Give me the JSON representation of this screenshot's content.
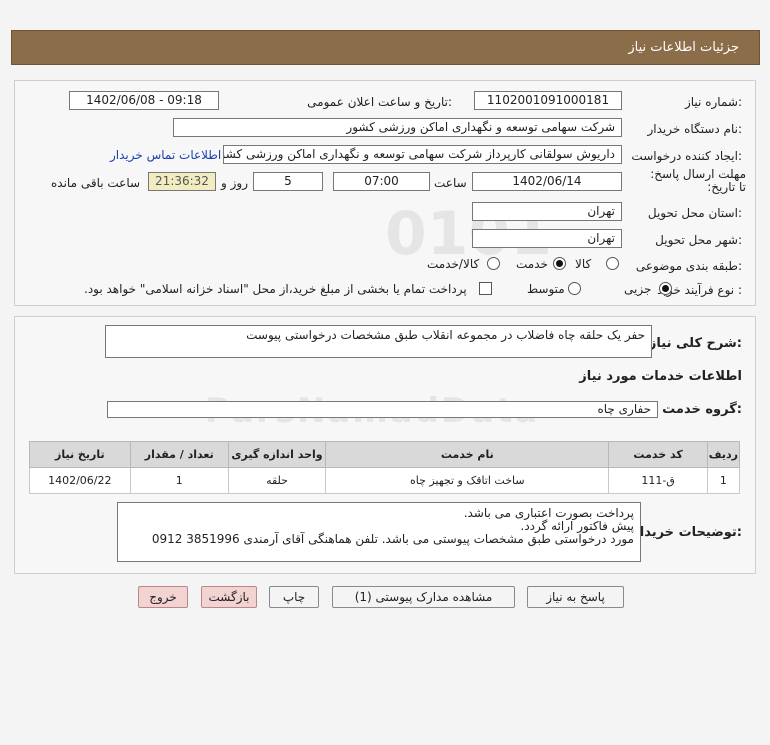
{
  "header": {
    "title": "جزئیات اطلاعات نیاز"
  },
  "form": {
    "need_number_label": "شماره نیاز:",
    "need_number": "1102001091000181",
    "announce_label": "تاریخ و ساعت اعلان عمومی:",
    "announce_value": "1402/06/08 - 09:18",
    "buyer_org_label": "نام دستگاه خریدار:",
    "buyer_org": "شرکت سهامی توسعه و نگهداری اماکن ورزشی کشور",
    "creator_label": "ایجاد کننده درخواست:",
    "creator": "داریوش سولقانی کارپرداز شرکت سهامی توسعه و نگهداری اماکن ورزشی کشو",
    "contact_link": "اطلاعات تماس خریدار",
    "deadline_label": "مهلت ارسال پاسخ: تا تاریخ:",
    "deadline_date": "1402/06/14",
    "time_label": "ساعت",
    "deadline_time": "07:00",
    "days_value": "5",
    "days_label": "روز و",
    "remaining_time": "21:36:32",
    "remaining_label": "ساعت باقی مانده",
    "province_label": "استان محل تحویل:",
    "province": "تهران",
    "city_label": "شهر محل تحویل:",
    "city": "تهران",
    "category_label": "طبقه بندی موضوعی:",
    "category_options": [
      "کالا",
      "خدمت",
      "کالا/خدمت"
    ],
    "process_label": "نوع فرآیند خرید :",
    "process_options": [
      "جزیی",
      "متوسط"
    ],
    "payment_note": "پرداخت تمام یا بخشی از مبلغ خرید،از محل \"اسناد خزانه اسلامی\" خواهد بود."
  },
  "details": {
    "summary_label": "شرح کلی نیاز:",
    "summary": "حفر یک حلقه چاه فاضلاب در مجموعه انقلاب طبق مشخصات درخواستی پیوست",
    "services_title": "اطلاعات خدمات مورد نیاز",
    "service_group_label": "گروه خدمت:",
    "service_group": "حفاری چاه",
    "table": {
      "headers": [
        "ردیف",
        "کد خدمت",
        "نام خدمت",
        "واحد اندازه گیری",
        "تعداد / مقدار",
        "تاریخ نیاز"
      ],
      "rows": [
        [
          "1",
          "ق-111",
          "ساخت اتاقک و تجهیز چاه",
          "حلقه",
          "1",
          "1402/06/22"
        ]
      ]
    },
    "notes_label": "توضیحات خریدار:",
    "notes": [
      "پرداخت بصورت اعتباری می باشد.",
      "پیش فاکتور ارائه گردد.",
      "مورد درخواستی طبق مشخصات پیوستی می باشد. تلفن هماهنگی آقای آرمندی 3851996  0912"
    ]
  },
  "buttons": {
    "reply": "پاسخ به نیاز",
    "view_docs": "مشاهده مدارک پیوستی (1)",
    "print": "چاپ",
    "back": "بازگشت",
    "exit": "خروج"
  }
}
